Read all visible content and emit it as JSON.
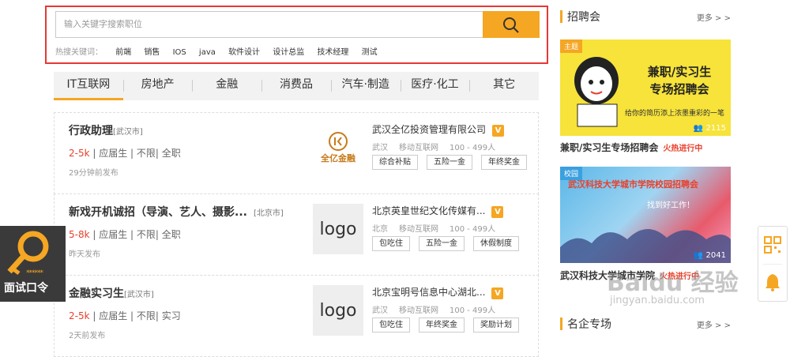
{
  "search": {
    "placeholder": "输入关键字搜索职位",
    "hot_label": "热搜关键词：",
    "hot_keywords": [
      "前端",
      "销售",
      "IOS",
      "java",
      "软件设计",
      "设计总监",
      "技术经理",
      "测试"
    ]
  },
  "tabs": [
    "IT互联网",
    "房地产",
    "金融",
    "消费品",
    "汽车·制造",
    "医疗·化工",
    "其它"
  ],
  "jobs": [
    {
      "title": "行政助理",
      "city": "[武汉市]",
      "salary": "2-5k",
      "meta": " | 应届生 | 不限| 全职",
      "time": "29分钟前发布",
      "logo_text": "全亿金融",
      "company": "武汉全亿投资管理有限公司",
      "location": "武汉",
      "industry": "移动互联网",
      "size": "100 - 499人",
      "tags": [
        "综合补贴",
        "五险一金",
        "年终奖金"
      ]
    },
    {
      "title": "新戏开机诚招（导演、艺人、摄影...",
      "city": "[北京市]",
      "salary": "5-8k",
      "meta": " | 应届生 | 不限| 全职",
      "time": "昨天发布",
      "logo_text": "logo",
      "company": "北京英皇世纪文化传媒有...",
      "location": "北京",
      "industry": "移动互联网",
      "size": "100 - 499人",
      "tags": [
        "包吃住",
        "五险一金",
        "休假制度"
      ]
    },
    {
      "title": "金融实习生",
      "city": "[武汉市]",
      "salary": "2-5k",
      "meta": " | 应届生 | 不限| 实习",
      "time": "2天前发布",
      "logo_text": "logo",
      "company": "北京宝明号信息中心湖北...",
      "location": "武汉",
      "industry": "移动互联网",
      "size": "100 - 499人",
      "tags": [
        "包吃住",
        "年终奖金",
        "奖励计划"
      ]
    }
  ],
  "verified_badge": "V",
  "sidebar": {
    "fairs_heading": "招聘会",
    "more": "更多 > >",
    "fairs": [
      {
        "badge": "主题",
        "count": "2115",
        "banner_line1": "兼职/实习生",
        "banner_line2": "专场招聘会",
        "banner_sub": "给你的简历添上浓墨重彩的一笔",
        "title": "兼职/实习生专场招聘会",
        "status": "火热进行中"
      },
      {
        "badge": "校园",
        "count": "2041",
        "banner_line1": "武汉科技大学城市学院校园招聘会",
        "banner_sub": "找到好工作！",
        "title": "武汉科技大学城市学院",
        "status": "火热进行中"
      }
    ],
    "companies_heading": "名企专场"
  },
  "float_left": {
    "label": "面试口令",
    "stars": "******"
  },
  "watermark": {
    "brand": "Baidu 经验",
    "url": "jingyan.baidu.com"
  },
  "colors": {
    "accent": "#f5a623",
    "salary": "#e8402b",
    "highlight_border": "#e53935"
  }
}
